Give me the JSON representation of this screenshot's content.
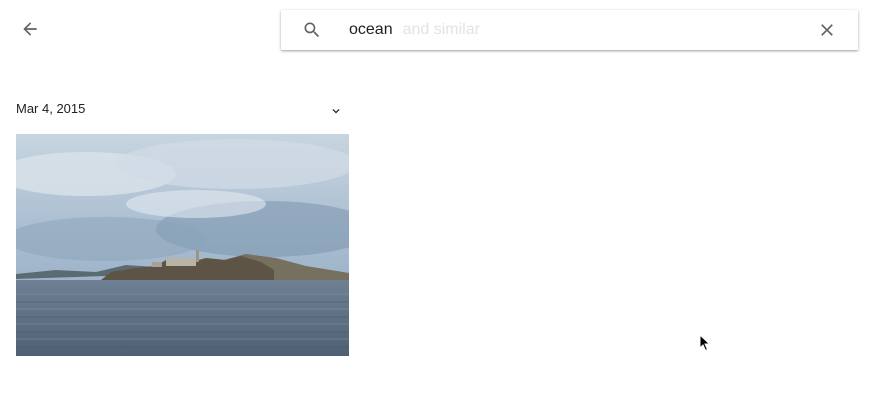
{
  "header": {
    "back_icon": "arrow-back-icon"
  },
  "search": {
    "query": "ocean",
    "suggestion": "and similar",
    "search_icon": "search-icon",
    "clear_icon": "close-icon"
  },
  "results": {
    "groups": [
      {
        "date": "Mar 4, 2015",
        "toggle_icon": "chevron-down-icon",
        "photos": [
          {
            "subject": "island in a bay under cloudy sky"
          }
        ]
      }
    ]
  },
  "colors": {
    "text_primary": "#212121",
    "icon_gray": "#5f6368",
    "suggest_text": "#e3e3e3"
  }
}
